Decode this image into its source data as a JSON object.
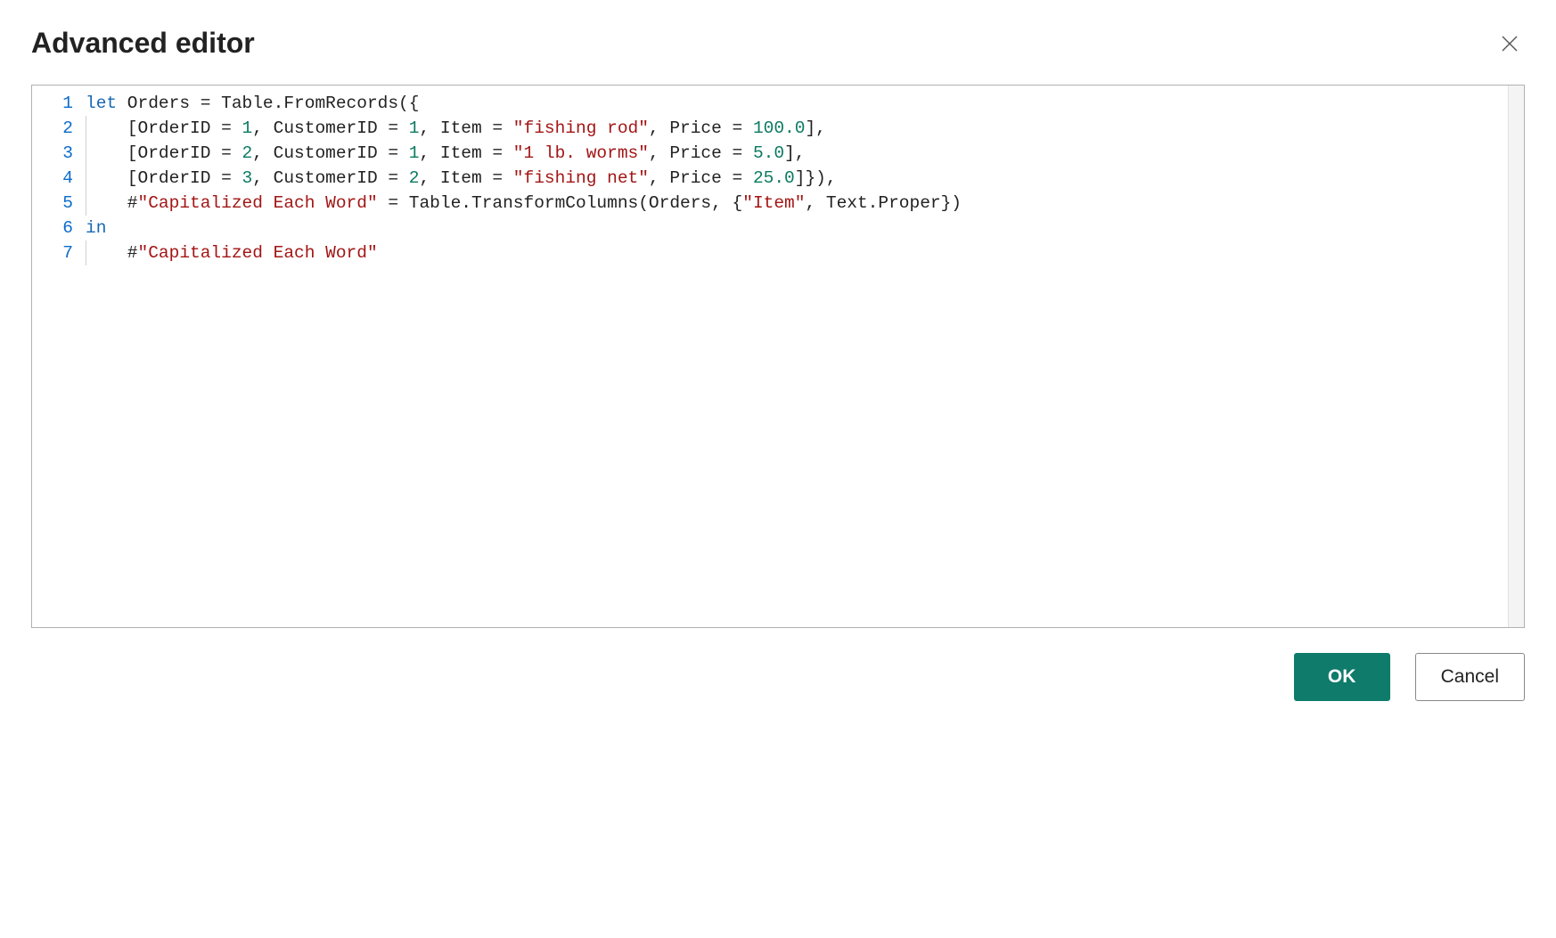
{
  "header": {
    "title": "Advanced editor"
  },
  "buttons": {
    "ok": "OK",
    "cancel": "Cancel"
  },
  "editor": {
    "lineNumbers": [
      "1",
      "2",
      "3",
      "4",
      "5",
      "6",
      "7"
    ],
    "lines": [
      [
        {
          "t": "let",
          "c": "tok-kw"
        },
        {
          "t": " Orders = Table.FromRecords({"
        }
      ],
      [
        {
          "t": "    [OrderID = "
        },
        {
          "t": "1",
          "c": "tok-num"
        },
        {
          "t": ", CustomerID = "
        },
        {
          "t": "1",
          "c": "tok-num"
        },
        {
          "t": ", Item = "
        },
        {
          "t": "\"fishing rod\"",
          "c": "tok-str"
        },
        {
          "t": ", Price = "
        },
        {
          "t": "100.0",
          "c": "tok-num"
        },
        {
          "t": "],"
        }
      ],
      [
        {
          "t": "    [OrderID = "
        },
        {
          "t": "2",
          "c": "tok-num"
        },
        {
          "t": ", CustomerID = "
        },
        {
          "t": "1",
          "c": "tok-num"
        },
        {
          "t": ", Item = "
        },
        {
          "t": "\"1 lb. worms\"",
          "c": "tok-str"
        },
        {
          "t": ", Price = "
        },
        {
          "t": "5.0",
          "c": "tok-num"
        },
        {
          "t": "],"
        }
      ],
      [
        {
          "t": "    [OrderID = "
        },
        {
          "t": "3",
          "c": "tok-num"
        },
        {
          "t": ", CustomerID = "
        },
        {
          "t": "2",
          "c": "tok-num"
        },
        {
          "t": ", Item = "
        },
        {
          "t": "\"fishing net\"",
          "c": "tok-str"
        },
        {
          "t": ", Price = "
        },
        {
          "t": "25.0",
          "c": "tok-num"
        },
        {
          "t": "]}),"
        }
      ],
      [
        {
          "t": "    #"
        },
        {
          "t": "\"Capitalized Each Word\"",
          "c": "tok-str"
        },
        {
          "t": " = Table.TransformColumns(Orders, {"
        },
        {
          "t": "\"Item\"",
          "c": "tok-str"
        },
        {
          "t": ", Text.Proper})"
        }
      ],
      [
        {
          "t": "in",
          "c": "tok-kw"
        }
      ],
      [
        {
          "t": "    #"
        },
        {
          "t": "\"Capitalized Each Word\"",
          "c": "tok-str"
        }
      ]
    ]
  }
}
